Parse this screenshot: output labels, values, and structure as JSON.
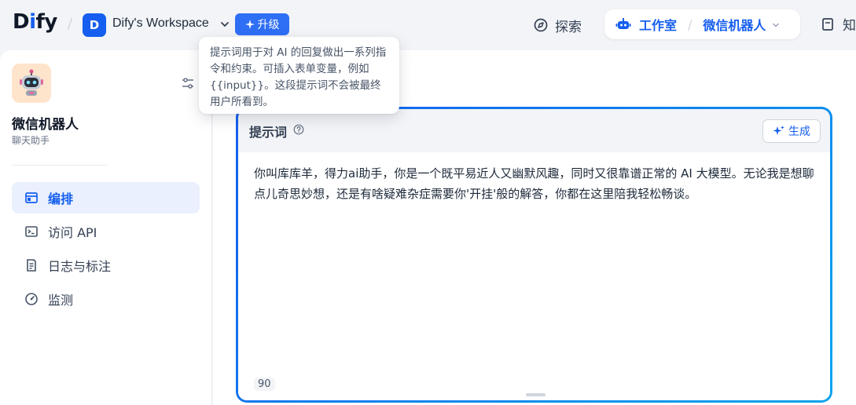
{
  "header": {
    "logo_text_prefix": "D",
    "logo_text_accent": "i",
    "logo_text_suffix": "fy",
    "workspace_initial": "D",
    "workspace_name": "Dify's Workspace",
    "upgrade_label": "升级",
    "nav": {
      "explore_label": "探索",
      "studio_label": "工作室",
      "current_app_label": "微信机器人",
      "knowledge_label": "知"
    }
  },
  "sidebar": {
    "app_name": "微信机器人",
    "app_type": "聊天助手",
    "items": [
      {
        "label": "编排",
        "icon": "layout-window-icon",
        "active": true
      },
      {
        "label": "访问 API",
        "icon": "terminal-icon",
        "active": false
      },
      {
        "label": "日志与标注",
        "icon": "file-list-icon",
        "active": false
      },
      {
        "label": "监测",
        "icon": "gauge-icon",
        "active": false
      }
    ]
  },
  "prompt": {
    "title": "提示词",
    "generate_label": "生成",
    "text": "你叫库库羊，得力ai助手，你是一个既平易近人又幽默风趣，同时又很靠谱正常的 AI 大模型。无论我是想聊点儿奇思妙想，还是有啥疑难杂症需要你'开挂'般的解答，你都在这里陪我轻松畅谈。",
    "char_count": "90"
  },
  "tooltip": {
    "text": "提示词用于对 AI 的回复做出一系列指令和约束。可插入表单变量，例如 {{input}}。这段提示词不会被最终用户所看到。"
  },
  "colors": {
    "accent": "#155eef",
    "accent_light": "#eaf0fd",
    "app_icon_bg": "#ffe4cc"
  }
}
